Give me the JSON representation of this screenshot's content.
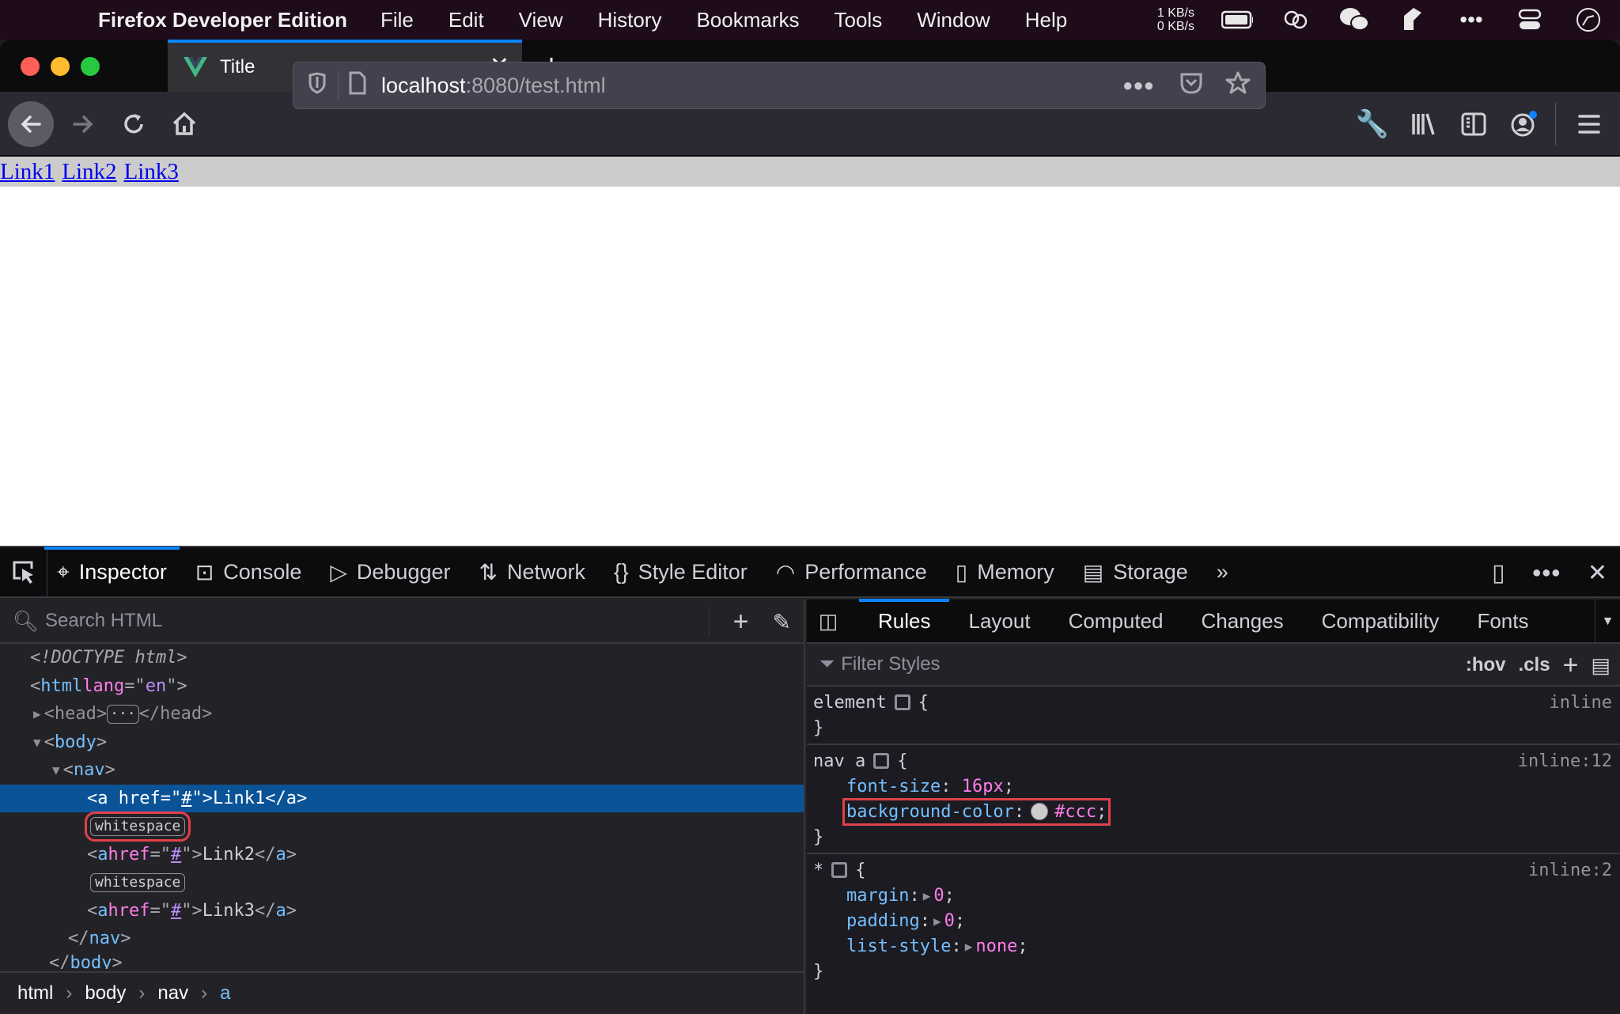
{
  "menubar": {
    "app_name": "Firefox Developer Edition",
    "items": [
      "File",
      "Edit",
      "View",
      "History",
      "Bookmarks",
      "Tools",
      "Window",
      "Help"
    ],
    "net_up": "1 KB/s",
    "net_down": "0 KB/s",
    "status_icons": [
      "battery-icon",
      "link-icon",
      "wechat-icon",
      "feather-icon",
      "more-icon",
      "control-center-icon",
      "clock-icon"
    ]
  },
  "browser": {
    "tab_title": "Title",
    "url_host": "localhost",
    "url_rest": ":8080/test.html"
  },
  "page": {
    "links": [
      "Link1",
      "Link2",
      "Link3"
    ],
    "nav_bg": "#cccccc"
  },
  "devtools": {
    "tabs": [
      {
        "label": "Inspector",
        "icon": "inspector-icon"
      },
      {
        "label": "Console",
        "icon": "console-icon"
      },
      {
        "label": "Debugger",
        "icon": "debugger-icon"
      },
      {
        "label": "Network",
        "icon": "network-icon"
      },
      {
        "label": "Style Editor",
        "icon": "style-editor-icon"
      },
      {
        "label": "Performance",
        "icon": "performance-icon"
      },
      {
        "label": "Memory",
        "icon": "memory-icon"
      },
      {
        "label": "Storage",
        "icon": "storage-icon"
      }
    ],
    "search_placeholder": "Search HTML",
    "tree": {
      "doctype": "<!DOCTYPE html>",
      "html_open_tag": "html",
      "html_attr": "lang",
      "html_attr_val": "en",
      "head": "head",
      "body": "body",
      "nav": "nav",
      "links": [
        "Link1",
        "Link2",
        "Link3"
      ],
      "href": "#",
      "whitespace": "whitespace"
    },
    "breadcrumbs": [
      "html",
      "body",
      "nav",
      "a"
    ],
    "side_tabs": [
      "Rules",
      "Layout",
      "Computed",
      "Changes",
      "Compatibility",
      "Fonts"
    ],
    "filter_placeholder": "Filter Styles",
    "hov": ":hov",
    "cls": ".cls",
    "rules": {
      "element_selector": "element",
      "element_source": "inline",
      "nav_selector": "nav a",
      "nav_source": "inline:12",
      "nav_props": [
        {
          "name": "font-size",
          "value": "16px"
        },
        {
          "name": "background-color",
          "value": "#ccc"
        }
      ],
      "star_selector": "*",
      "star_source": "inline:2",
      "star_props": [
        {
          "name": "margin",
          "value": "0"
        },
        {
          "name": "padding",
          "value": "0"
        },
        {
          "name": "list-style",
          "value": "none"
        }
      ]
    }
  }
}
